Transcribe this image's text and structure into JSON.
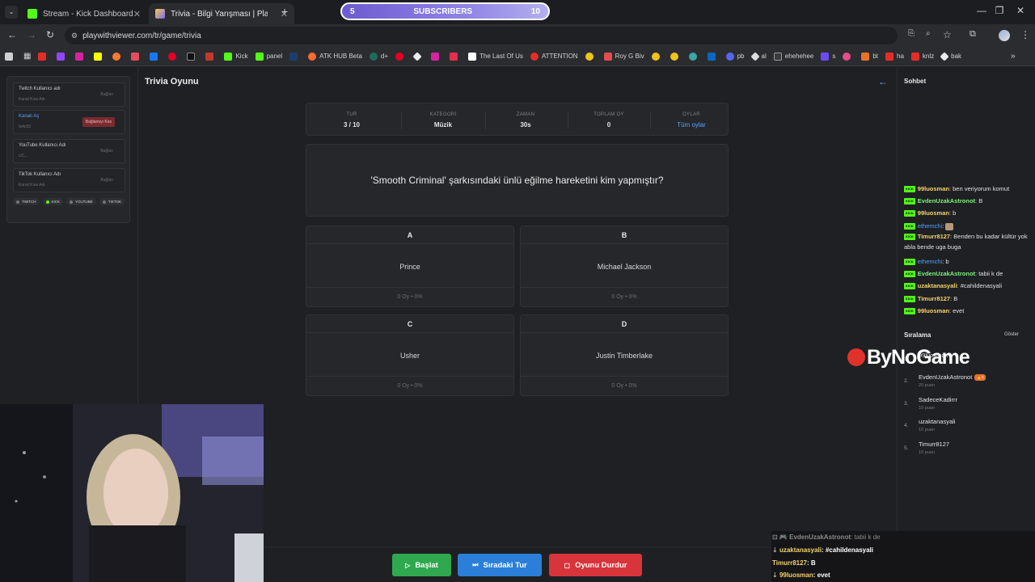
{
  "browser": {
    "tabs": [
      {
        "label": "Stream - Kick Dashboard"
      },
      {
        "label": "Trivia - Bilgi Yarışması | PlayWit"
      }
    ],
    "subscribers_banner": {
      "count_start": "5",
      "label": "SUBSCRIBERS",
      "count_end": "10",
      "progress": 0.5
    },
    "url": "playwithviewer.com/tr/game/trivia",
    "bookmarks": [
      "Kick",
      "panel",
      "ATK HUB Beta",
      "d+",
      "The Last Of Us",
      "ATTENTION",
      "Roy G Biv",
      "al",
      "pb",
      "ehehehee",
      "s",
      "bt",
      "ha",
      "knlz",
      "bak"
    ]
  },
  "sidebar": {
    "connections": [
      {
        "label": "Twitch Kullanıcı adı",
        "sub": "Kanal Kısa Adı",
        "button": "Bağlan"
      },
      {
        "label": "Kanalı Aç",
        "sub": "fa4c53",
        "button": "Bağlantıyı Kes"
      },
      {
        "label": "YouTube Kullanıcı Adı",
        "sub": "UC...",
        "button": "Bağlan"
      },
      {
        "label": "TikTok Kullanıcı Adı",
        "sub": "Kanal Kısa Adı",
        "button": "Bağlan"
      }
    ],
    "platform_pills": [
      "TWITCH",
      "KICK",
      "YOUTUBE",
      "TIKTOK"
    ]
  },
  "game": {
    "title": "Trivia Oyunu",
    "stats": [
      {
        "key": "TUR",
        "value": "3 / 10"
      },
      {
        "key": "KATEGORİ",
        "value": "Müzik"
      },
      {
        "key": "ZAMAN",
        "value": "30s"
      },
      {
        "key": "TOPLAM OY",
        "value": "0"
      },
      {
        "key": "OYLAR",
        "value": "Tüm oylar"
      }
    ],
    "question": "'Smooth Criminal' şarkısındaki ünlü eğilme hareketini kim yapmıştır?",
    "answers": [
      {
        "letter": "A",
        "text": "Prince",
        "votes": "0 Oy • 0%"
      },
      {
        "letter": "B",
        "text": "Michael Jackson",
        "votes": "0 Oy • 0%"
      },
      {
        "letter": "C",
        "text": "Usher",
        "votes": "0 Oy • 0%"
      },
      {
        "letter": "D",
        "text": "Justin Timberlake",
        "votes": "0 Oy • 0%"
      }
    ],
    "controls": {
      "start": "Başlat",
      "next": "Sıradaki Tur",
      "stop": "Oyunu Durdur"
    }
  },
  "chat": {
    "title": "Sohbet",
    "badge": "KICK",
    "messages": [
      {
        "user": "99luosman",
        "text": "ben veriyorum komut",
        "color": "#f5d26b"
      },
      {
        "user": "EvdenUzakAstronot",
        "text": "B",
        "color": "#7cf07c"
      },
      {
        "user": "99luosman",
        "text": "b",
        "color": "#f5d26b"
      },
      {
        "user": "ethemchi",
        "text": "",
        "color": "#4fa3ff"
      },
      {
        "user": "Timurr8127",
        "text": "Benden bu kadar kültür yok abla bende uga buga",
        "color": "#f5d26b"
      },
      {
        "user": "ethemchi",
        "text": "b",
        "color": "#4fa3ff"
      },
      {
        "user": "EvdenUzakAstronot",
        "text": "tabii k de",
        "color": "#7cf07c"
      },
      {
        "user": "uzaktanasyali",
        "text": "#cahildenasyali",
        "color": "#f5d26b"
      },
      {
        "user": "Timurr8127",
        "text": "B",
        "color": "#f5d26b"
      },
      {
        "user": "99luosman",
        "text": "evet",
        "color": "#f5d26b"
      }
    ]
  },
  "ranking": {
    "title": "Sıralama",
    "show": "Göster",
    "entries": [
      {
        "rank": "1.",
        "name": "99luosman",
        "points": ""
      },
      {
        "rank": "2.",
        "name": "EvdenUzakAstronot",
        "points": "20 puan",
        "tag": "🔥3"
      },
      {
        "rank": "3.",
        "name": "SadeceKadirrr",
        "points": "10 puan"
      },
      {
        "rank": "4.",
        "name": "uzaktanasyali",
        "points": "10 puan"
      },
      {
        "rank": "5.",
        "name": "Timurr8127",
        "points": "10 puan"
      }
    ]
  },
  "watermark": {
    "prefix": "By",
    "o": "N",
    "rest": "oGame"
  },
  "overlay_chat": [
    {
      "user": "EvdenUzakAstronot",
      "text": ": tabii k de",
      "color": "#8a8a8a"
    },
    {
      "user": "uzaktanasyali",
      "text": ": #cahildenasyali",
      "color": "#f5d26b"
    },
    {
      "user": "Timurr8127",
      "text": ": B",
      "color": "#f5d26b"
    },
    {
      "user": "99luosman",
      "text": ": evet",
      "color": "#f5d26b"
    }
  ]
}
